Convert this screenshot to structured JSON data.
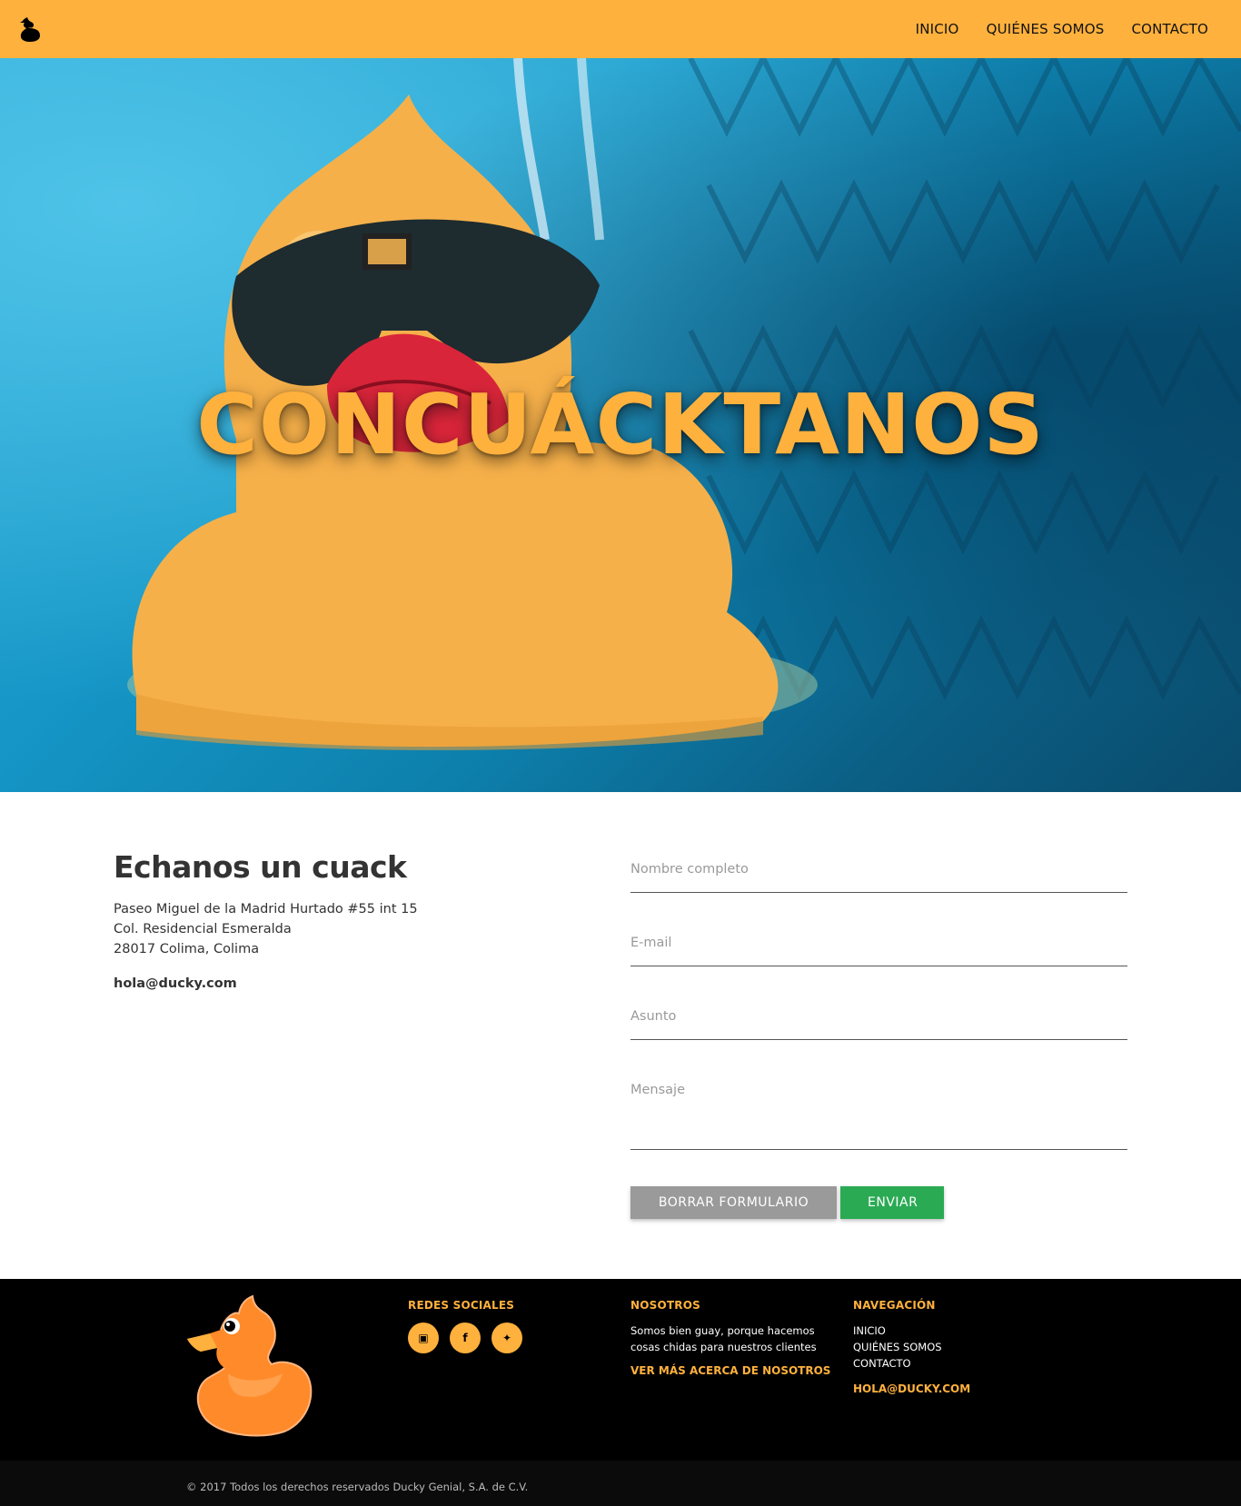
{
  "header": {
    "logo": "duck-logo-icon",
    "nav": [
      "INICIO",
      "QUIÉNES SOMOS",
      "CONTACTO"
    ]
  },
  "hero": {
    "title": "CONCUÁCKTANOS"
  },
  "contact": {
    "heading": "Echanos un cuack",
    "address_line1": "Paseo Miguel de la Madrid Hurtado #55 int 15",
    "address_line2": "Col. Residencial Esmeralda",
    "address_line3": "28017 Colima, Colima",
    "email": "hola@ducky.com"
  },
  "form": {
    "name_placeholder": "Nombre completo",
    "email_placeholder": "E-mail",
    "subject_placeholder": "Asunto",
    "message_placeholder": "Mensaje",
    "clear_label": "BORRAR FORMULARIO",
    "send_label": "ENVIAR"
  },
  "footer": {
    "social_title": "REDES SOCIALES",
    "social_icons": [
      "instagram-icon",
      "facebook-icon",
      "twitter-icon"
    ],
    "about_title": "NOSOTROS",
    "about_text": "Somos bien guay, porque hacemos cosas chidas para nuestros clientes",
    "about_link": "VER MÁS ACERCA DE NOSOTROS",
    "nav_title": "NAVEGACIÓN",
    "nav": [
      "INICIO",
      "QUIÉNES SOMOS",
      "CONTACTO"
    ],
    "email": "HOLA@DUCKY.COM",
    "copyright": "© 2017 Todos los derechos reservados Ducky Genial, S.A. de C.V."
  },
  "colors": {
    "brand": "#FFB13D",
    "send": "#2BAA54",
    "clear": "#9A9A9A",
    "footer_bg": "#000000"
  }
}
